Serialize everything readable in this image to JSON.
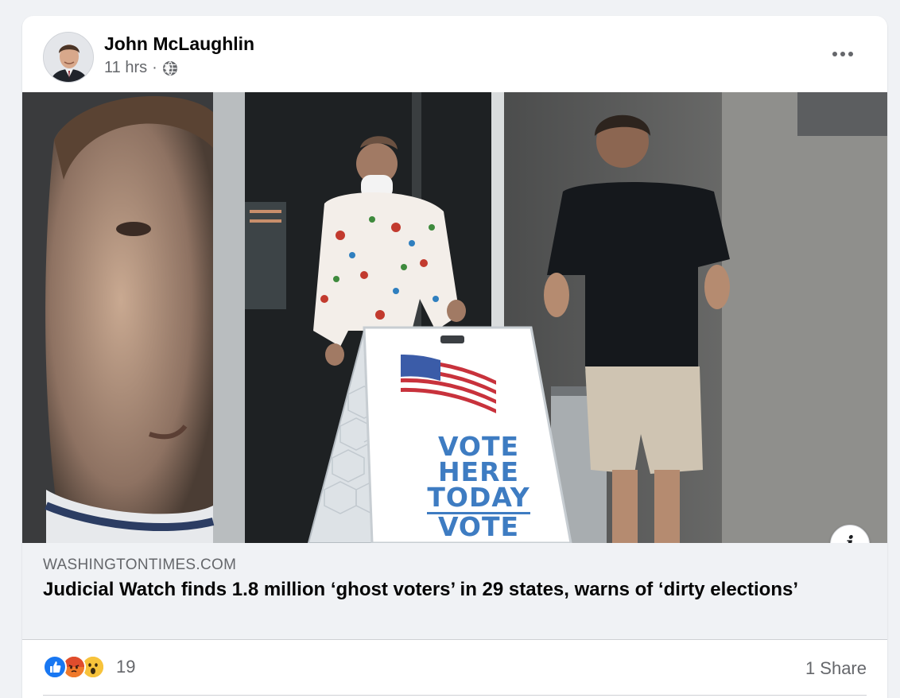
{
  "post": {
    "author": "John McLaughlin",
    "time": "11 hrs",
    "separator": "·",
    "visibility_icon": "globe-icon",
    "more_icon": "more-options-icon"
  },
  "media": {
    "sign_lines": [
      "VOTE",
      "HERE",
      "TODAY",
      "VOTE"
    ],
    "info_icon_glyph": "i"
  },
  "link_preview": {
    "domain": "WASHINGTONTIMES.COM",
    "title": "Judicial Watch finds 1.8 million ‘ghost voters’ in 29 states, warns of ‘dirty elections’"
  },
  "engagement": {
    "reaction_icons": [
      "like-icon",
      "angry-icon",
      "wow-icon"
    ],
    "reaction_count": "19",
    "shares": "1 Share"
  },
  "colors": {
    "like_blue": "#1877f2",
    "angry_orange": "#e9710f",
    "wow_yellow": "#f7b125",
    "secondary_text": "#65676b"
  }
}
